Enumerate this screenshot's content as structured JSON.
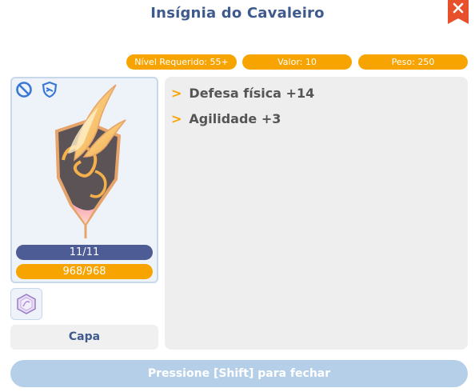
{
  "window": {
    "title": "Insígnia do Cavaleiro"
  },
  "stats": {
    "required_level": "Nível Requerido: 55+",
    "value": "Valor: 10",
    "weight": "Peso: 250"
  },
  "item": {
    "durability": "11/11",
    "experience": "968/968",
    "category": "Capa",
    "icons": [
      "block-icon",
      "shield-icon",
      "emblem-art",
      "card-slot-icon"
    ]
  },
  "description": {
    "lines": [
      "Defesa física +14",
      "Agilidade +3"
    ],
    "bullet": ">"
  },
  "footer": {
    "close_hint": "Pressione [Shift] para fechar"
  },
  "colors": {
    "accent_orange": "#f7a400",
    "title_blue": "#3f5a8c",
    "bar_blue": "#4e5c96",
    "close_red": "#e8502c",
    "footer_blue": "#b6cfe9"
  }
}
